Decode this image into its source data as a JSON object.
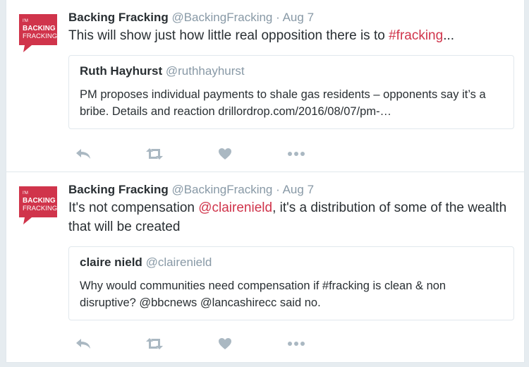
{
  "colors": {
    "brand": "#d0344b",
    "icon_gray": "#aab8c2",
    "meta_gray": "#8899a6"
  },
  "tweets": [
    {
      "avatar": {
        "line1": "I'M",
        "line2": "BACKING",
        "line3": "FRACKING"
      },
      "name": "Backing Fracking",
      "handle": "@BackingFracking",
      "separator": "·",
      "time": "Aug 7",
      "text_before": "This will show just how little real opposition there is to ",
      "text_link": "#fracking",
      "text_after": "...",
      "quote": {
        "name": "Ruth Hayhurst",
        "handle": "@ruthhayhurst",
        "text": "PM proposes individual payments to shale gas residents – opponents say it’s a bribe. Details and reaction drillordrop.com/2016/08/07/pm-…"
      },
      "actions": [
        "reply-icon",
        "retweet-icon",
        "like-icon",
        "more-icon"
      ]
    },
    {
      "avatar": {
        "line1": "I'M",
        "line2": "BACKING",
        "line3": "FRACKING"
      },
      "name": "Backing Fracking",
      "handle": "@BackingFracking",
      "separator": "·",
      "time": "Aug 7",
      "text_before": "It's not compensation ",
      "text_link": "@clairenield",
      "text_after": ", it's a distribution of some of the wealth that will be created",
      "quote": {
        "name": "claire nield",
        "handle": "@clairenield",
        "text": "Why would communities need compensation if #fracking is clean & non disruptive? @bbcnews @lancashirecc said no."
      },
      "actions": [
        "reply-icon",
        "retweet-icon",
        "like-icon",
        "more-icon"
      ]
    }
  ]
}
